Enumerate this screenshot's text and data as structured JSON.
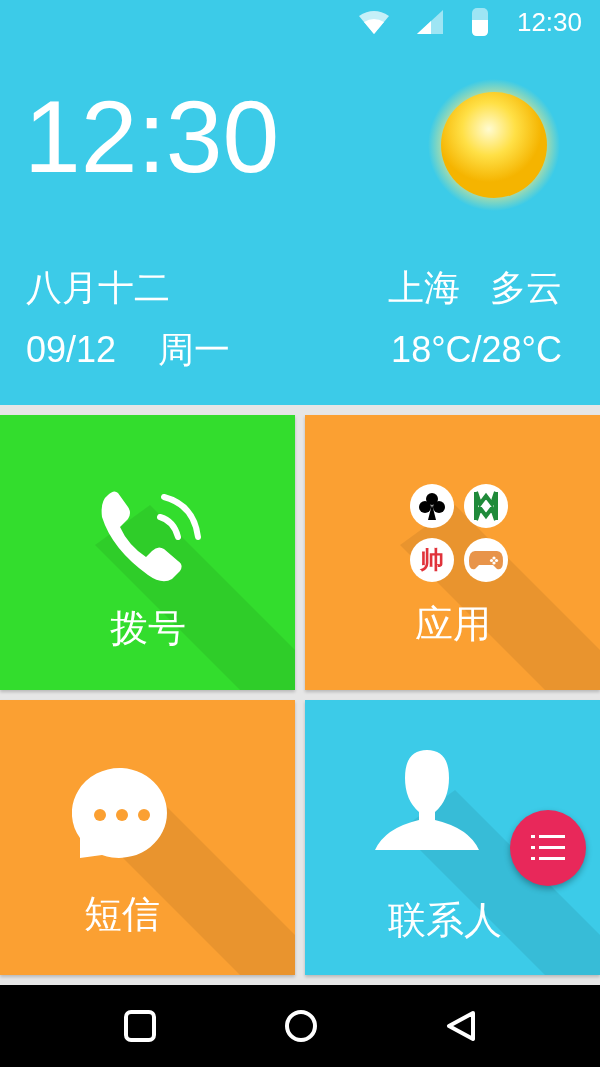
{
  "status_bar": {
    "time": "12:30"
  },
  "header": {
    "clock": "12:30",
    "lunar_date": "八月十二",
    "date": "09/12",
    "weekday": "周一",
    "city": "上海",
    "weather": "多云",
    "temperature": "18°C/28°C"
  },
  "tiles": [
    {
      "kind": "phone",
      "label": "拨号",
      "color": "#33dd2d"
    },
    {
      "kind": "apps",
      "label": "应用",
      "color": "#fba032",
      "apps": [
        {
          "kind": "club"
        },
        {
          "kind": "wm"
        },
        {
          "kind": "char",
          "text": "帅"
        },
        {
          "kind": "gamepad"
        }
      ]
    },
    {
      "kind": "sms",
      "label": "短信",
      "color": "#fba032"
    },
    {
      "kind": "contacts",
      "label": "联系人",
      "color": "#3ccbe8"
    }
  ],
  "fab": {
    "kind": "menu"
  }
}
